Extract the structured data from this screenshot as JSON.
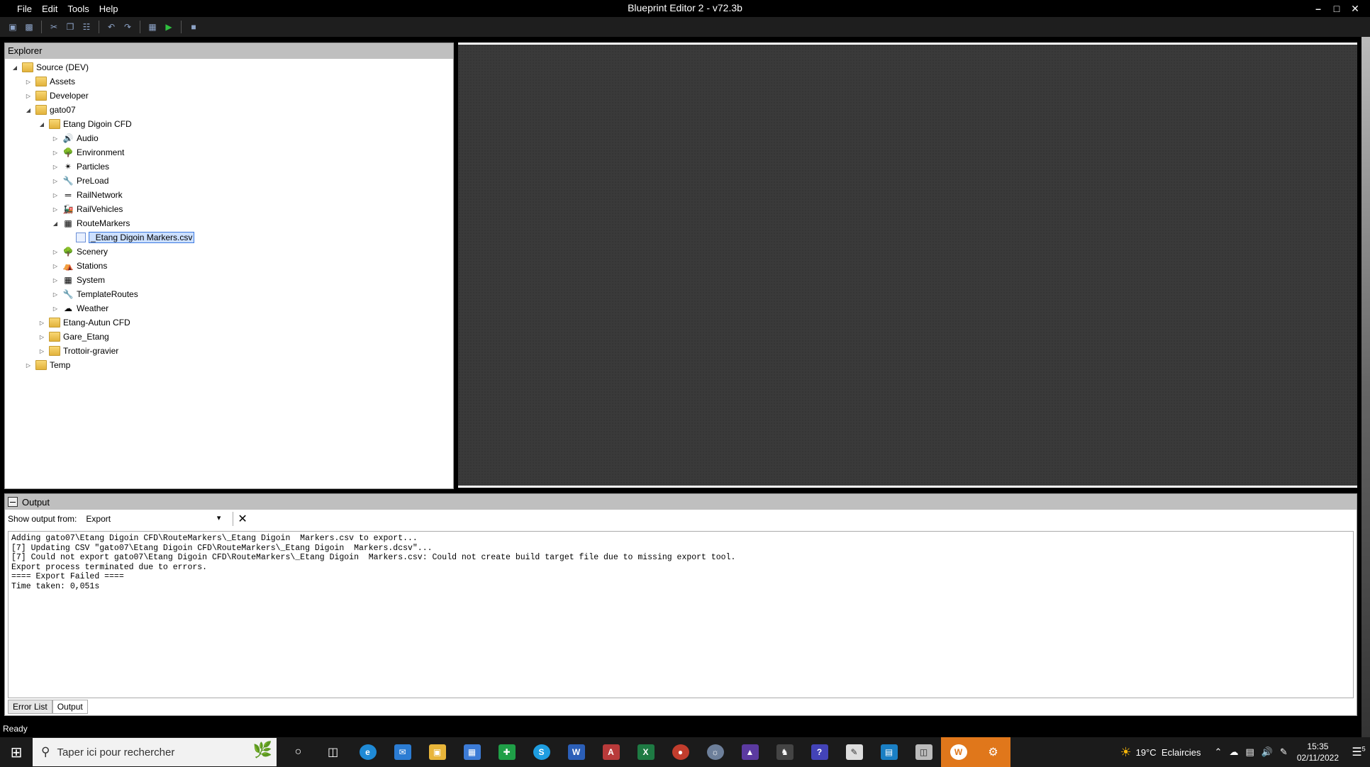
{
  "window": {
    "title": "Blueprint Editor 2 - v72.3b"
  },
  "menu": [
    "File",
    "Edit",
    "Tools",
    "Help"
  ],
  "explorer": {
    "header": "Explorer",
    "tree": [
      {
        "label": "Source (DEV)",
        "level": 0,
        "state": "open",
        "icon": "folder"
      },
      {
        "label": "Assets",
        "level": 1,
        "state": "closed",
        "icon": "folder"
      },
      {
        "label": "Developer",
        "level": 1,
        "state": "closed",
        "icon": "folder"
      },
      {
        "label": "gato07",
        "level": 1,
        "state": "open",
        "icon": "folder"
      },
      {
        "label": "Etang Digoin CFD",
        "level": 2,
        "state": "open",
        "icon": "folder"
      },
      {
        "label": "Audio",
        "level": 3,
        "state": "closed",
        "icon": "audio"
      },
      {
        "label": "Environment",
        "level": 3,
        "state": "closed",
        "icon": "environment"
      },
      {
        "label": "Particles",
        "level": 3,
        "state": "closed",
        "icon": "particles"
      },
      {
        "label": "PreLoad",
        "level": 3,
        "state": "closed",
        "icon": "preload"
      },
      {
        "label": "RailNetwork",
        "level": 3,
        "state": "closed",
        "icon": "railnetwork"
      },
      {
        "label": "RailVehicles",
        "level": 3,
        "state": "closed",
        "icon": "railvehicles"
      },
      {
        "label": "RouteMarkers",
        "level": 3,
        "state": "open",
        "icon": "routemarkers"
      },
      {
        "label": "_Etang Digoin  Markers.csv",
        "level": 4,
        "state": "leaf",
        "icon": "file",
        "selected": true
      },
      {
        "label": "Scenery",
        "level": 3,
        "state": "closed",
        "icon": "scenery"
      },
      {
        "label": "Stations",
        "level": 3,
        "state": "closed",
        "icon": "stations"
      },
      {
        "label": "System",
        "level": 3,
        "state": "closed",
        "icon": "system"
      },
      {
        "label": "TemplateRoutes",
        "level": 3,
        "state": "closed",
        "icon": "preload"
      },
      {
        "label": "Weather",
        "level": 3,
        "state": "closed",
        "icon": "weather"
      },
      {
        "label": "Etang-Autun CFD",
        "level": 2,
        "state": "closed",
        "icon": "folder"
      },
      {
        "label": "Gare_Etang",
        "level": 2,
        "state": "closed",
        "icon": "folder"
      },
      {
        "label": "Trottoir-gravier",
        "level": 2,
        "state": "closed",
        "icon": "folder"
      },
      {
        "label": "Temp",
        "level": 1,
        "state": "closed",
        "icon": "folder"
      }
    ]
  },
  "output": {
    "header": "Output",
    "show_from_label": "Show output from:",
    "show_from_value": "Export",
    "log_lines": [
      "Adding gato07\\Etang Digoin CFD\\RouteMarkers\\_Etang Digoin  Markers.csv to export...",
      "[7] Updating CSV \"gato07\\Etang Digoin CFD\\RouteMarkers\\_Etang Digoin  Markers.dcsv\"...",
      "[7] Could not export gato07\\Etang Digoin CFD\\RouteMarkers\\_Etang Digoin  Markers.csv: Could not create build target file due to missing export tool.",
      "Export process terminated due to errors.",
      "==== Export Failed ====",
      "Time taken: 0,051s"
    ],
    "tabs": [
      "Error List",
      "Output"
    ]
  },
  "status": {
    "text": "Ready"
  },
  "taskbar": {
    "search_placeholder": "Taper ici pour rechercher",
    "weather_temp": "19°C",
    "weather_text": "Eclaircies",
    "time": "15:35",
    "date": "02/11/2022",
    "notification_count": "5"
  }
}
